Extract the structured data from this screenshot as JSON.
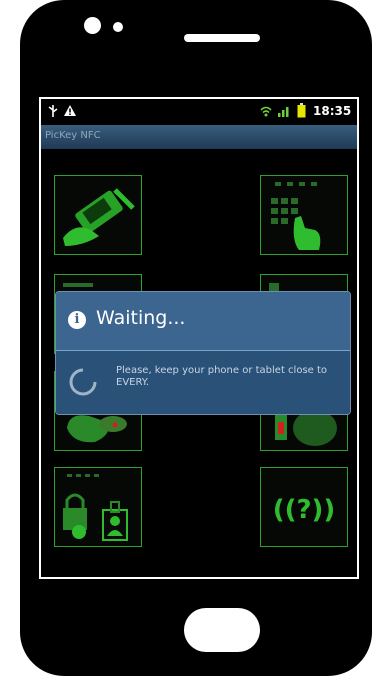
{
  "status_bar": {
    "time": "18:35",
    "left_icons": [
      "usb-icon",
      "warning-icon"
    ],
    "right_icons": [
      "wifi-icon",
      "signal-icon",
      "battery-icon"
    ]
  },
  "app": {
    "title": "PicKey NFC"
  },
  "dialog": {
    "title": "Waiting...",
    "message": "Please, keep your phone or tablet close to EVERY."
  },
  "colors": {
    "tile_border": "#2ea02e",
    "dialog_header": "#3c6690",
    "dialog_body": "#2a5178",
    "screen_bg": "#000000",
    "phone_body": "#000000"
  }
}
